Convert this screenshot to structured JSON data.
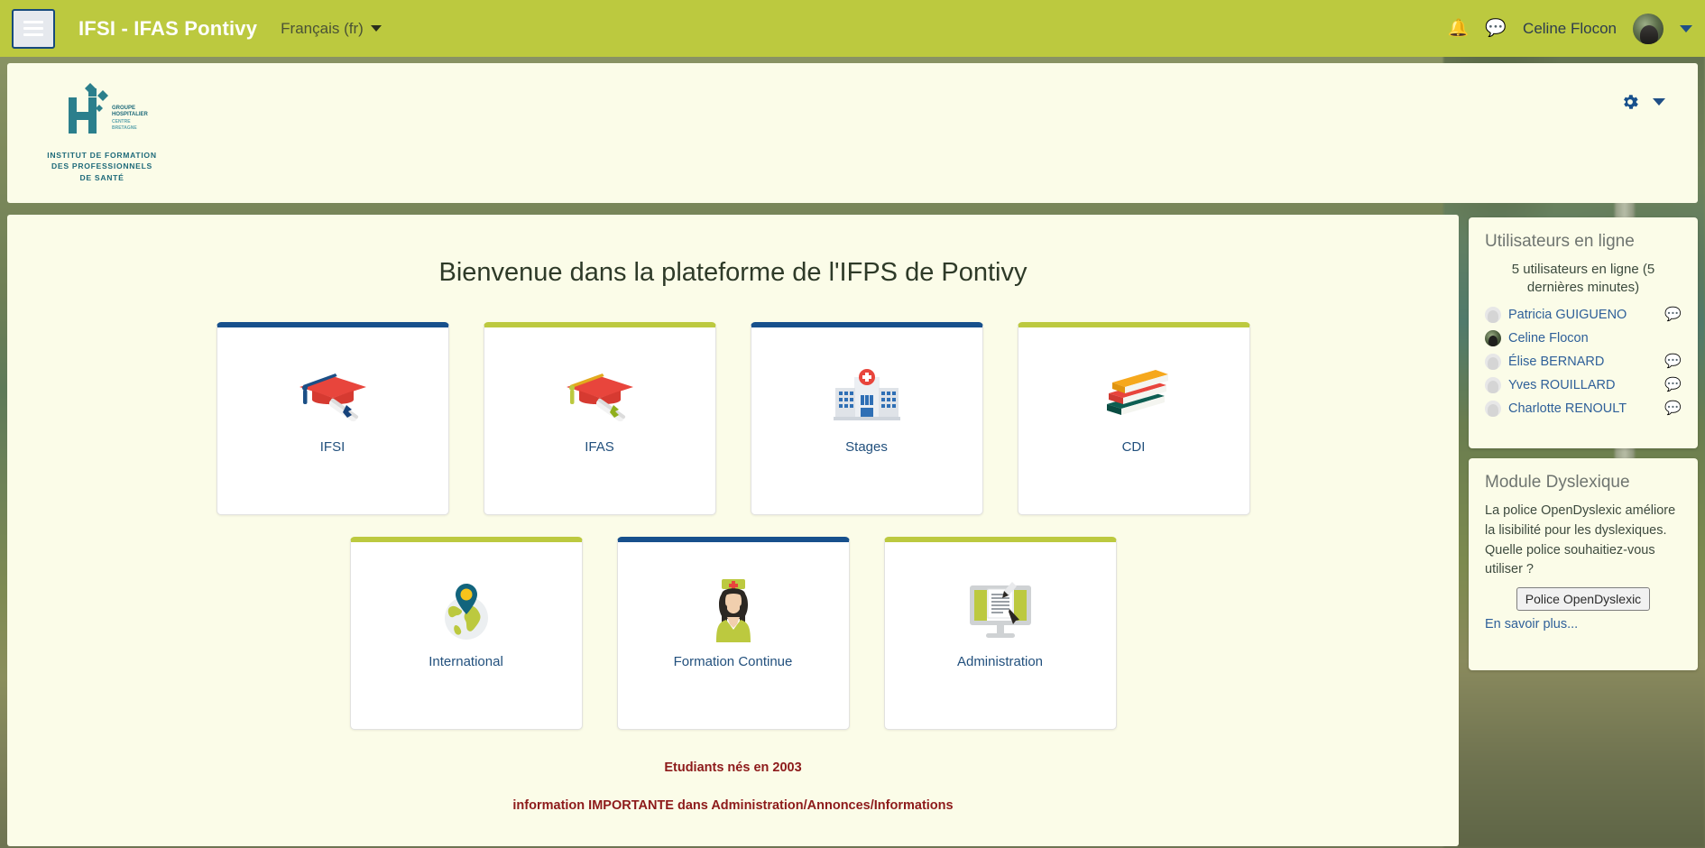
{
  "navbar": {
    "menu_icon": "hamburger-icon",
    "brand": "IFSI - IFAS Pontivy",
    "language": "Français (fr)",
    "notifications_icon": "bell-icon",
    "messages_icon": "speech-bubble-icon",
    "user_name": "Celine Flocon",
    "avatar": "user-avatar",
    "accent_color": "#bcc93f"
  },
  "header": {
    "logo_mark_lines": [
      "GROUPE",
      "HOSPITALIER",
      "CENTRE",
      "BRETAGNE"
    ],
    "logo_text": "INSTITUT DE FORMATION DES PROFESSIONNELS DE SANTÉ",
    "logo_text_lines": [
      "INSTITUT DE FORMATION",
      "DES PROFESSIONNELS",
      "DE SANTÉ"
    ],
    "gear_icon": "gear-icon",
    "gear_caret_icon": "chevron-down-icon",
    "logo_color": "#1e6a7a"
  },
  "main": {
    "title": "Bienvenue dans la plateforme de l'IFPS de Pontivy",
    "tiles_row1": [
      {
        "label": "IFSI",
        "icon": "graduation-cap-icon",
        "accent": "#17508c"
      },
      {
        "label": "IFAS",
        "icon": "graduation-cap-icon",
        "accent": "#bcc93f"
      },
      {
        "label": "Stages",
        "icon": "hospital-icon",
        "accent": "#17508c"
      },
      {
        "label": "CDI",
        "icon": "books-icon",
        "accent": "#bcc93f"
      }
    ],
    "tiles_row2": [
      {
        "label": "International",
        "icon": "globe-pin-icon",
        "accent": "#bcc93f"
      },
      {
        "label": "Formation Continue",
        "icon": "nurse-icon",
        "accent": "#17508c"
      },
      {
        "label": "Administration",
        "icon": "monitor-doc-icon",
        "accent": "#bcc93f"
      }
    ],
    "notice1": "Etudiants nés en 2003",
    "notice2": "information IMPORTANTE dans Administration/Annonces/Informations",
    "notice_color": "#8d1a1a"
  },
  "sidebar": {
    "online_block": {
      "title": "Utilisateurs en ligne",
      "count_text": "5 utilisateurs en ligne (5 dernières minutes)",
      "users": [
        {
          "name": "Patricia GUIGUENO",
          "has_message": true,
          "is_self": false
        },
        {
          "name": "Celine Flocon",
          "has_message": false,
          "is_self": true
        },
        {
          "name": "Élise BERNARD",
          "has_message": true,
          "is_self": false
        },
        {
          "name": "Yves ROUILLARD",
          "has_message": true,
          "is_self": false
        },
        {
          "name": "Charlotte RENOULT",
          "has_message": true,
          "is_self": false
        }
      ]
    },
    "dyslexic_block": {
      "title": "Module Dyslexique",
      "paragraph1": "La police OpenDyslexic améliore la lisibilité pour les dyslexiques.",
      "paragraph2": "Quelle police souhaitiez-vous utiliser ?",
      "button": "Police OpenDyslexic",
      "link": "En savoir plus..."
    }
  }
}
